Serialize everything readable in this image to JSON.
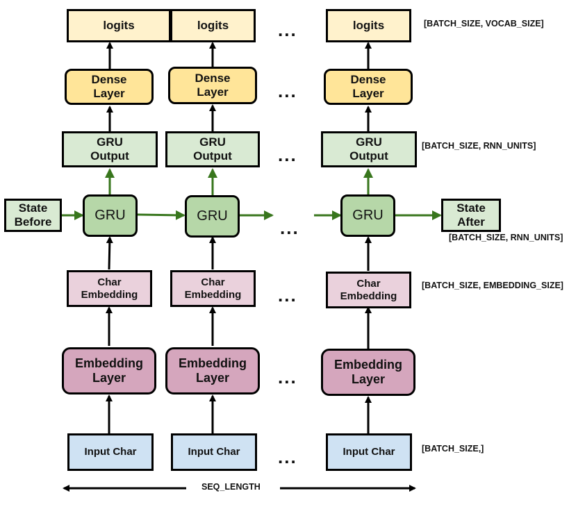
{
  "diagram": {
    "columns": [
      {
        "logits": "logits",
        "dense": "Dense Layer",
        "gru_output": "GRU Output",
        "gru": "GRU",
        "char_embedding": "Char Embedding",
        "embedding_layer": "Embedding Layer",
        "input": "Input Char"
      },
      {
        "logits": "logits",
        "dense": "Dense Layer",
        "gru_output": "GRU Output",
        "gru": "GRU",
        "char_embedding": "Char Embedding",
        "embedding_layer": "Embedding Layer",
        "input": "Input Char"
      },
      {
        "logits": "logits",
        "dense": "Dense Layer",
        "gru_output": "GRU Output",
        "gru": "GRU",
        "char_embedding": "Char Embedding",
        "embedding_layer": "Embedding Layer",
        "input": "Input Char"
      }
    ],
    "state_before": "State Before",
    "state_after": "State After",
    "ellipsis": "...",
    "shape_labels": {
      "logits": "[BATCH_SIZE, VOCAB_SIZE]",
      "gru_output": "[BATCH_SIZE, RNN_UNITS]",
      "state_after": "[BATCH_SIZE, RNN_UNITS]",
      "char_embedding": "[BATCH_SIZE, EMBEDDING_SIZE]",
      "input": "[BATCH_SIZE,]"
    },
    "seq_length_label": "SEQ_LENGTH",
    "colors": {
      "logits": "#fff2cc",
      "dense": "#ffe599",
      "gru_output": "#d9ead3",
      "gru": "#b6d7a8",
      "state": "#d9ead3",
      "char_embedding": "#ead1dc",
      "embedding_layer": "#d5a6bd",
      "input": "#cfe2f3",
      "state_arrow": "#38761d",
      "data_arrow": "#000000"
    }
  }
}
